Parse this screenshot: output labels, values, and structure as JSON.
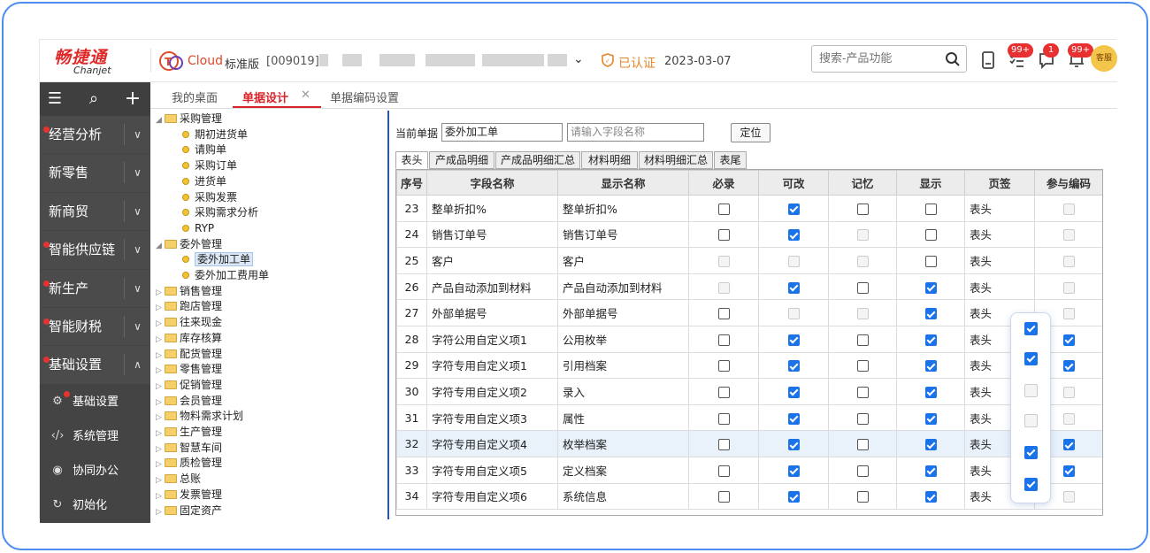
{
  "brand": {
    "cn": "畅捷通",
    "en": "Chanjet"
  },
  "product": {
    "name": "Cloud",
    "edition": "标准版"
  },
  "company": {
    "code": "[009019]"
  },
  "cert": {
    "label": "已认证"
  },
  "date": "2023-03-07",
  "search": {
    "placeholder": "搜索-产品功能"
  },
  "badges": {
    "tasks": "99+",
    "messages": "1",
    "notices": "99+"
  },
  "avatar_label": "客服",
  "sidebar": {
    "items": [
      {
        "label": "经营分析",
        "dot": true,
        "arrow": "∨"
      },
      {
        "label": "新零售",
        "dot": false,
        "arrow": "∨"
      },
      {
        "label": "新商贸",
        "dot": false,
        "arrow": "∨"
      },
      {
        "label": "智能供应链",
        "dot": true,
        "arrow": "∨"
      },
      {
        "label": "新生产",
        "dot": true,
        "arrow": "∨"
      },
      {
        "label": "智能财税",
        "dot": true,
        "arrow": "∨"
      },
      {
        "label": "基础设置",
        "dot": true,
        "arrow": "∧"
      }
    ],
    "subitems": [
      {
        "label": "基础设置",
        "icon": "⚙"
      },
      {
        "label": "系统管理",
        "icon": "‹/›"
      },
      {
        "label": "协同办公",
        "icon": "◉"
      },
      {
        "label": "初始化",
        "icon": "↻"
      }
    ]
  },
  "tabs": [
    {
      "label": "我的桌面",
      "active": false
    },
    {
      "label": "单据设计",
      "active": true
    },
    {
      "label": "单据编码设置",
      "active": false
    }
  ],
  "tree": [
    {
      "label": "采购管理",
      "type": "folder",
      "open": true,
      "indent": 0
    },
    {
      "label": "期初进货单",
      "type": "leaf",
      "indent": 1
    },
    {
      "label": "请购单",
      "type": "leaf",
      "indent": 1
    },
    {
      "label": "采购订单",
      "type": "leaf",
      "indent": 1
    },
    {
      "label": "进货单",
      "type": "leaf",
      "indent": 1
    },
    {
      "label": "采购发票",
      "type": "leaf",
      "indent": 1
    },
    {
      "label": "采购需求分析",
      "type": "leaf",
      "indent": 1
    },
    {
      "label": "RYP",
      "type": "leaf",
      "indent": 1
    },
    {
      "label": "委外管理",
      "type": "folder",
      "open": true,
      "indent": 0
    },
    {
      "label": "委外加工单",
      "type": "leaf",
      "indent": 1,
      "selected": true
    },
    {
      "label": "委外加工费用单",
      "type": "leaf",
      "indent": 1
    },
    {
      "label": "销售管理",
      "type": "folder",
      "open": false,
      "indent": 0
    },
    {
      "label": "跑店管理",
      "type": "folder",
      "open": false,
      "indent": 0
    },
    {
      "label": "往来现金",
      "type": "folder",
      "open": false,
      "indent": 0
    },
    {
      "label": "库存核算",
      "type": "folder",
      "open": false,
      "indent": 0
    },
    {
      "label": "配货管理",
      "type": "folder",
      "open": false,
      "indent": 0
    },
    {
      "label": "零售管理",
      "type": "folder",
      "open": false,
      "indent": 0
    },
    {
      "label": "促销管理",
      "type": "folder",
      "open": false,
      "indent": 0
    },
    {
      "label": "会员管理",
      "type": "folder",
      "open": false,
      "indent": 0
    },
    {
      "label": "物料需求计划",
      "type": "folder",
      "open": false,
      "indent": 0
    },
    {
      "label": "生产管理",
      "type": "folder",
      "open": false,
      "indent": 0
    },
    {
      "label": "智慧车间",
      "type": "folder",
      "open": false,
      "indent": 0
    },
    {
      "label": "质检管理",
      "type": "folder",
      "open": false,
      "indent": 0
    },
    {
      "label": "总账",
      "type": "folder",
      "open": false,
      "indent": 0
    },
    {
      "label": "发票管理",
      "type": "folder",
      "open": false,
      "indent": 0
    },
    {
      "label": "固定资产",
      "type": "folder",
      "open": false,
      "indent": 0
    }
  ],
  "current_doc": {
    "label": "当前单据",
    "value": "委外加工单",
    "field_placeholder": "请输入字段名称",
    "locate_label": "定位"
  },
  "subtabs": [
    "表头",
    "产成品明细",
    "产成品明细汇总",
    "材料明细",
    "材料明细汇总",
    "表尾"
  ],
  "table": {
    "headers": [
      "序号",
      "字段名称",
      "显示名称",
      "必录",
      "可改",
      "记忆",
      "显示",
      "页签",
      "参与编码"
    ],
    "rows": [
      {
        "no": "23",
        "field": "整单折扣%",
        "display": "整单折扣%",
        "req": "off",
        "edit": "on",
        "mem": "off",
        "show": "off",
        "tab": "表头",
        "code": "dis"
      },
      {
        "no": "24",
        "field": "销售订单号",
        "display": "销售订单号",
        "req": "off",
        "edit": "on",
        "mem": "dis",
        "show": "off",
        "tab": "表头",
        "code": "dis"
      },
      {
        "no": "25",
        "field": "客户",
        "display": "客户",
        "req": "dis",
        "edit": "dis",
        "mem": "dis",
        "show": "off",
        "tab": "表头",
        "code": "dis"
      },
      {
        "no": "26",
        "field": "产品自动添加到材料",
        "display": "产品自动添加到材料",
        "req": "dis",
        "edit": "on",
        "mem": "off",
        "show": "on",
        "tab": "表头",
        "code": "dis"
      },
      {
        "no": "27",
        "field": "外部单据号",
        "display": "外部单据号",
        "req": "off",
        "edit": "dis",
        "mem": "dis",
        "show": "on",
        "tab": "表头",
        "code": "dis"
      },
      {
        "no": "28",
        "field": "字符公用自定义项1",
        "display": "公用枚举",
        "req": "off",
        "edit": "on",
        "mem": "off",
        "show": "on",
        "tab": "表头",
        "code": "on"
      },
      {
        "no": "29",
        "field": "字符专用自定义项1",
        "display": "引用档案",
        "req": "off",
        "edit": "on",
        "mem": "off",
        "show": "on",
        "tab": "表头",
        "code": "on"
      },
      {
        "no": "30",
        "field": "字符专用自定义项2",
        "display": "录入",
        "req": "off",
        "edit": "on",
        "mem": "off",
        "show": "on",
        "tab": "表头",
        "code": "dis"
      },
      {
        "no": "31",
        "field": "字符专用自定义项3",
        "display": "属性",
        "req": "off",
        "edit": "on",
        "mem": "off",
        "show": "on",
        "tab": "表头",
        "code": "dis"
      },
      {
        "no": "32",
        "field": "字符专用自定义项4",
        "display": "枚举档案",
        "req": "off",
        "edit": "on",
        "mem": "off",
        "show": "on",
        "tab": "表头",
        "code": "on",
        "highlight": true
      },
      {
        "no": "33",
        "field": "字符专用自定义项5",
        "display": "定义档案",
        "req": "off",
        "edit": "on",
        "mem": "off",
        "show": "on",
        "tab": "表头",
        "code": "on"
      },
      {
        "no": "34",
        "field": "字符专用自定义项6",
        "display": "系统信息",
        "req": "off",
        "edit": "on",
        "mem": "off",
        "show": "on",
        "tab": "表头",
        "code": "dis"
      }
    ]
  },
  "overlay_checks": [
    "on",
    "on",
    "dis",
    "dis",
    "on",
    "on"
  ],
  "colors": {
    "accent": "#d9232a",
    "checkbox": "#1a73e8",
    "sidebar": "#4b4b4b",
    "frame": "#4a8cf0"
  }
}
